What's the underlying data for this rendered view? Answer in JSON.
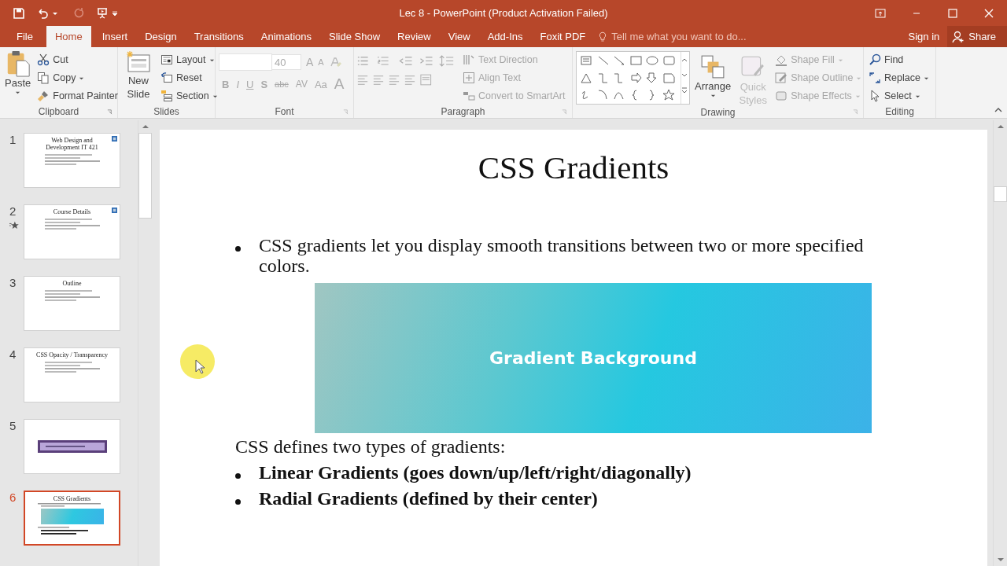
{
  "window": {
    "title": "Lec 8 - PowerPoint (Product Activation Failed)"
  },
  "tabs": [
    {
      "label": "File",
      "selected": false
    },
    {
      "label": "Home",
      "selected": true
    },
    {
      "label": "Insert",
      "selected": false
    },
    {
      "label": "Design",
      "selected": false
    },
    {
      "label": "Transitions",
      "selected": false
    },
    {
      "label": "Animations",
      "selected": false
    },
    {
      "label": "Slide Show",
      "selected": false
    },
    {
      "label": "Review",
      "selected": false
    },
    {
      "label": "View",
      "selected": false
    },
    {
      "label": "Add-Ins",
      "selected": false
    },
    {
      "label": "Foxit PDF",
      "selected": false
    }
  ],
  "tell_me": {
    "placeholder": "Tell me what you want to do..."
  },
  "sign_in": "Sign in",
  "share": "Share",
  "ribbon": {
    "clipboard": {
      "label": "Clipboard",
      "paste": "Paste",
      "items": [
        {
          "label": "Cut",
          "dropdown": false
        },
        {
          "label": "Copy",
          "dropdown": true
        },
        {
          "label": "Format Painter",
          "dropdown": false
        }
      ]
    },
    "slides": {
      "label": "Slides",
      "new_slide": "New Slide",
      "items": [
        {
          "label": "Layout",
          "dropdown": true
        },
        {
          "label": "Reset",
          "dropdown": false
        },
        {
          "label": "Section",
          "dropdown": true
        }
      ]
    },
    "font": {
      "label": "Font",
      "font_size": "40",
      "row1": [
        "A",
        "A"
      ],
      "row2": [
        "B",
        "I",
        "U",
        "S",
        "abc",
        "AV",
        "Aa",
        "A"
      ]
    },
    "paragraph": {
      "label": "Paragraph",
      "items": [
        {
          "label": "Text Direction",
          "disabled": true
        },
        {
          "label": "Align Text",
          "disabled": true
        },
        {
          "label": "Convert to SmartArt",
          "disabled": true
        }
      ]
    },
    "drawing": {
      "label": "Drawing",
      "arrange": "Arrange",
      "quick_styles": {
        "label": "Quick Styles",
        "disabled": true
      },
      "items": [
        {
          "label": "Shape Fill",
          "disabled": true
        },
        {
          "label": "Shape Outline",
          "disabled": true
        },
        {
          "label": "Shape Effects",
          "disabled": true
        }
      ]
    },
    "editing": {
      "label": "Editing",
      "items": [
        {
          "label": "Find",
          "dropdown": false
        },
        {
          "label": "Replace",
          "dropdown": true
        },
        {
          "label": "Select",
          "dropdown": true
        }
      ]
    }
  },
  "thumbnails": [
    {
      "number": "1",
      "title": "Web Design and Development IT 421",
      "kind": "text",
      "logo": true,
      "animated": false,
      "selected": false
    },
    {
      "number": "2",
      "title": "Course Details",
      "kind": "text",
      "logo": true,
      "animated": true,
      "selected": false
    },
    {
      "number": "3",
      "title": "Outline",
      "kind": "text",
      "logo": false,
      "animated": false,
      "selected": false
    },
    {
      "number": "4",
      "title": "CSS Opacity / Transparency",
      "kind": "text",
      "logo": false,
      "animated": false,
      "selected": false
    },
    {
      "number": "5",
      "kind": "banner",
      "logo": false,
      "animated": false,
      "selected": false
    },
    {
      "number": "6",
      "title": "CSS Gradients",
      "kind": "gradient",
      "logo": false,
      "animated": false,
      "selected": true
    }
  ],
  "slide": {
    "title": "CSS Gradients",
    "intro_bullet": "CSS gradients let you display smooth transitions between two or more specified colors.",
    "gradient_box": {
      "label": "Gradient Background"
    },
    "body": "CSS defines two types of gradients:",
    "bullets": [
      "Linear Gradients (goes down/up/left/right/diagonally)",
      "Radial Gradients (defined by their center)"
    ]
  }
}
